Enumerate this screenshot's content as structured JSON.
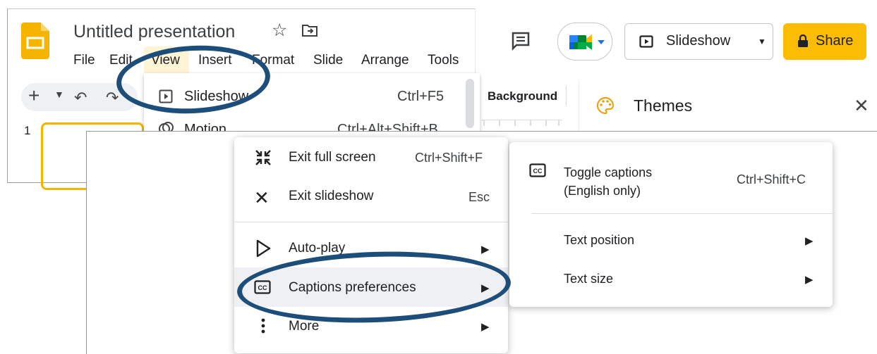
{
  "header": {
    "doc_title": "Untitled presentation",
    "menu": [
      "File",
      "Edit",
      "View",
      "Insert",
      "Format",
      "Slide",
      "Arrange",
      "Tools"
    ]
  },
  "toolbar": {
    "background_label": "Background",
    "slide_number": "1"
  },
  "actions": {
    "slideshow_label": "Slideshow",
    "share_label": "Share"
  },
  "themes_panel": {
    "title": "Themes"
  },
  "view_menu": {
    "items": [
      {
        "label": "Slideshow",
        "shortcut": "Ctrl+F5"
      },
      {
        "label": "Motion",
        "shortcut": "Ctrl+Alt+Shift+B"
      }
    ]
  },
  "context_menu": {
    "items": [
      {
        "label": "Exit full screen",
        "shortcut": "Ctrl+Shift+F",
        "icon": "exit-fullscreen-icon"
      },
      {
        "label": "Exit slideshow",
        "shortcut": "Esc",
        "icon": "close-icon"
      },
      {
        "label": "Auto-play",
        "icon": "play-icon"
      },
      {
        "label": "Captions preferences",
        "icon": "closed-captions-icon"
      },
      {
        "label": "More",
        "icon": "more-vertical-icon"
      }
    ]
  },
  "captions_submenu": {
    "toggle_line1": "Toggle captions",
    "toggle_line2": "(English only)",
    "toggle_shortcut": "Ctrl+Shift+C",
    "text_position": "Text position",
    "text_size": "Text size"
  },
  "colors": {
    "accent_yellow": "#fbbc04",
    "annotation_blue": "#1d4e7a",
    "view_highlight": "#fef4d6"
  }
}
